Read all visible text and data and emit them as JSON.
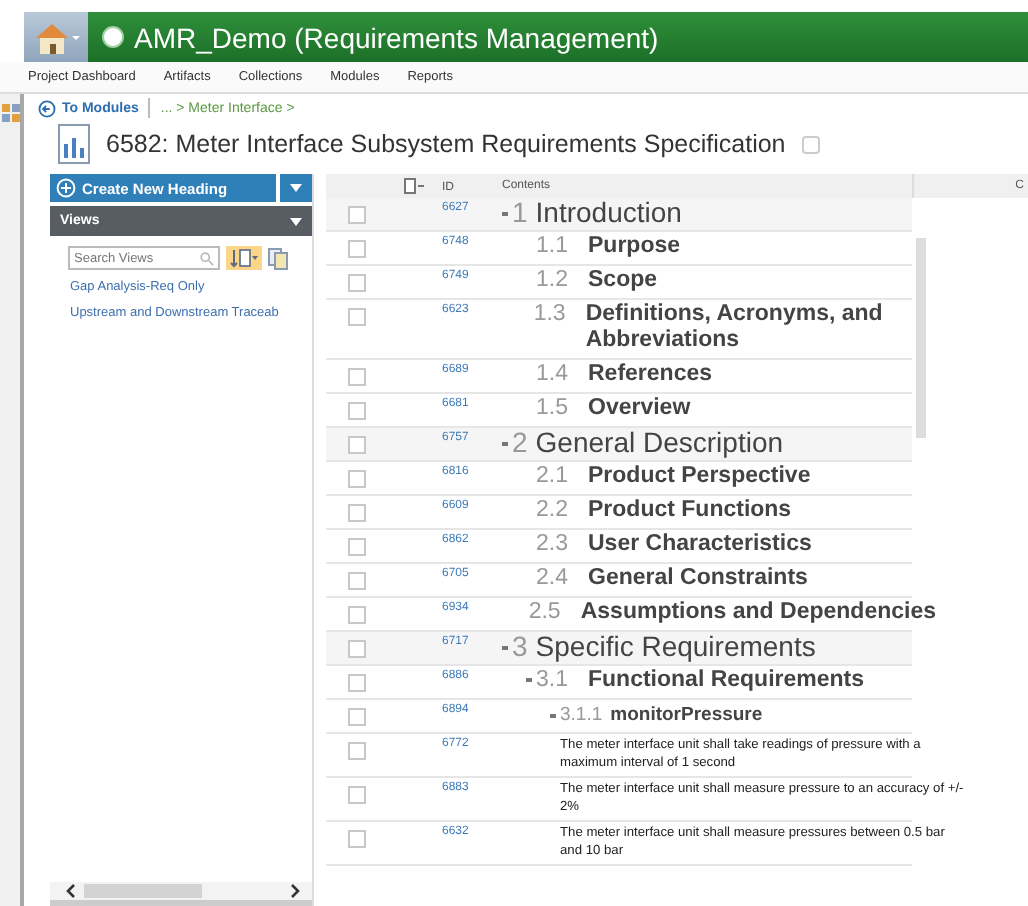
{
  "app_bar": {
    "title": "AMR_Demo (Requirements Management)"
  },
  "menu": [
    "Project Dashboard",
    "Artifacts",
    "Collections",
    "Modules",
    "Reports"
  ],
  "breadcrumb": {
    "back": "To Modules",
    "path": "... > Meter Interface >"
  },
  "page_title": "6582: Meter Interface Subsystem Requirements Specification",
  "sidebar": {
    "create_button": "Create New Heading",
    "section": "Views",
    "search": {
      "placeholder": "Search Views"
    },
    "views": [
      "Gap Analysis-Req Only",
      "Upstream and Downstream Traceab"
    ]
  },
  "table": {
    "columns": [
      "ID",
      "Contents",
      "C"
    ],
    "rows": [
      {
        "id": "6627",
        "number": "1",
        "title": "Introduction",
        "checked": false,
        "expanded": true,
        "children": [
          {
            "id": "6748",
            "number": "1.1",
            "title": "Purpose",
            "checked": false
          },
          {
            "id": "6749",
            "number": "1.2",
            "title": "Scope",
            "checked": false
          },
          {
            "id": "6623",
            "number": "1.3",
            "title": "Definitions, Acronyms, and Abbreviations",
            "checked": false
          },
          {
            "id": "6689",
            "number": "1.4",
            "title": "References",
            "checked": false
          },
          {
            "id": "6681",
            "number": "1.5",
            "title": "Overview",
            "checked": false
          }
        ]
      },
      {
        "id": "6757",
        "number": "2",
        "title": "General Description",
        "checked": false,
        "expanded": true,
        "children": [
          {
            "id": "6816",
            "number": "2.1",
            "title": "Product Perspective",
            "checked": false
          },
          {
            "id": "6609",
            "number": "2.2",
            "title": "Product Functions",
            "checked": false
          },
          {
            "id": "6862",
            "number": "2.3",
            "title": "User Characteristics",
            "checked": false
          },
          {
            "id": "6705",
            "number": "2.4",
            "title": "General Constraints",
            "checked": false
          },
          {
            "id": "6934",
            "number": "2.5",
            "title": "Assumptions and Dependencies",
            "checked": false
          }
        ]
      },
      {
        "id": "6717",
        "number": "3",
        "title": "Specific Requirements",
        "checked": false,
        "expanded": true,
        "children": [
          {
            "id": "6886",
            "number": "3.1",
            "title": "Functional Requirements",
            "checked": false,
            "expanded": true,
            "children": [
              {
                "id": "6894",
                "number": "3.1.1",
                "title": "monitorPressure",
                "checked": false,
                "expanded": true,
                "children": [
                  {
                    "id": "6772",
                    "text": "The meter interface unit shall take readings of pressure with a maximum interval of 1 second",
                    "checked": false
                  },
                  {
                    "id": "6883",
                    "text": "The meter interface unit shall measure pressure to an accuracy of +/- 2%",
                    "checked": false
                  },
                  {
                    "id": "6632",
                    "text": "The meter interface unit shall measure pressures between 0.5 bar and 10 bar",
                    "checked": false
                  }
                ]
              }
            ]
          }
        ]
      }
    ]
  }
}
